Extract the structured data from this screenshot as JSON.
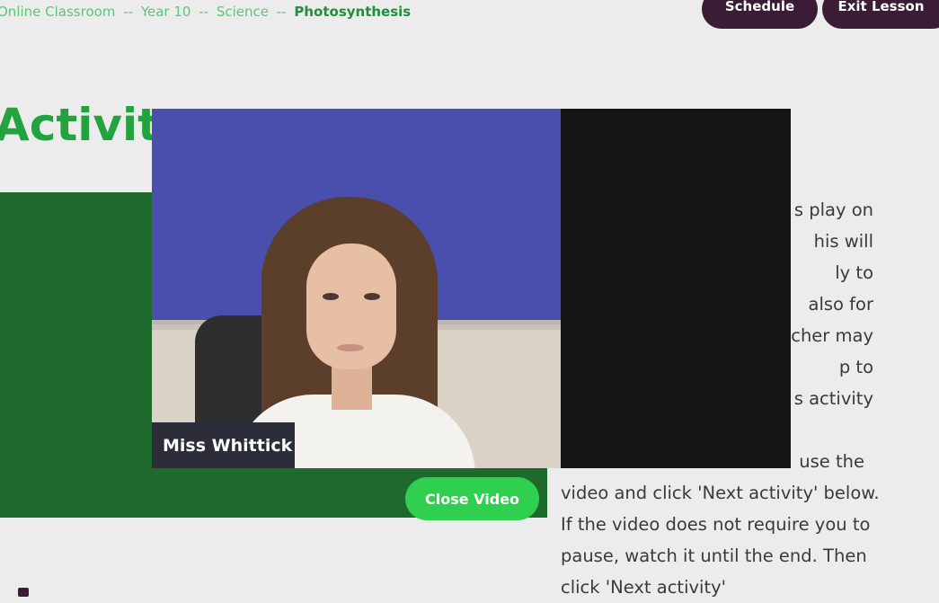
{
  "breadcrumb": {
    "items": [
      "Online Classroom",
      "Year 10",
      "Science"
    ],
    "separator": "--",
    "current": "Photosynthesis"
  },
  "header": {
    "schedule_label": "Schedule",
    "exit_label": "Exit Lesson"
  },
  "page": {
    "title": "Activity"
  },
  "instructions": {
    "visible_fragments": [
      "s play on",
      "his will",
      "ly to",
      "also for",
      "cher may",
      "p to",
      "s activity"
    ],
    "paragraph_2_first_line": "use the",
    "paragraph_2_rest": "video and click 'Next activity' below. If the video does not require you to pause, watch it until the end. Then click 'Next activity'"
  },
  "video_modal": {
    "participant_name": "Miss Whittick",
    "close_label": "Close Video"
  },
  "colors": {
    "brand_green": "#23a33f",
    "panel_green": "#1d6a2c",
    "button_dark": "#3a1c34",
    "close_button": "#2fcf4f"
  }
}
